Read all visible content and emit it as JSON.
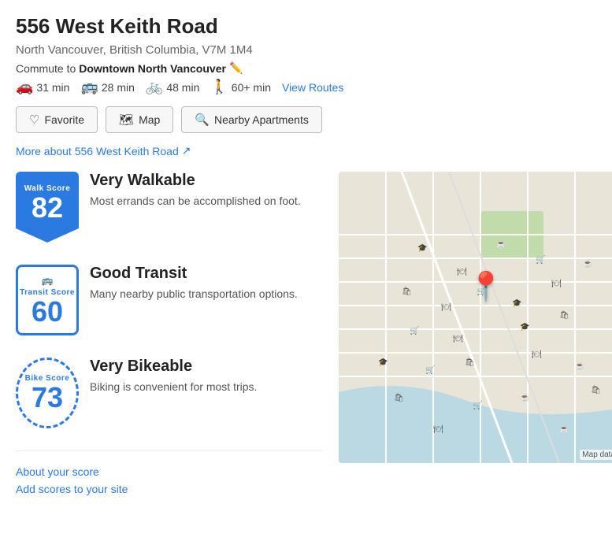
{
  "header": {
    "title": "556 West Keith Road",
    "subtitle": "North Vancouver, British Columbia, V7M 1M4",
    "commute_label": "Commute to",
    "commute_destination": "Downtown North Vancouver",
    "transport": [
      {
        "icon": "🚗",
        "time": "31 min",
        "name": "drive"
      },
      {
        "icon": "🚌",
        "time": "28 min",
        "name": "transit"
      },
      {
        "icon": "🚲",
        "time": "48 min",
        "name": "bike"
      },
      {
        "icon": "🚶",
        "time": "60+ min",
        "name": "walk"
      }
    ],
    "view_routes_label": "View Routes"
  },
  "buttons": [
    {
      "label": "Favorite",
      "icon": "♡",
      "name": "favorite"
    },
    {
      "label": "Map",
      "icon": "🗺",
      "name": "map"
    },
    {
      "label": "Nearby Apartments",
      "icon": "🔍",
      "name": "nearby"
    }
  ],
  "more_link": "More about 556 West Keith Road",
  "scores": [
    {
      "type": "walk",
      "badge_label": "Walk Score",
      "number": "82",
      "title": "Very Walkable",
      "description": "Most errands can be accomplished on foot."
    },
    {
      "type": "transit",
      "badge_label": "Transit Score",
      "number": "60",
      "title": "Good Transit",
      "description": "Many nearby public transportation options."
    },
    {
      "type": "bike",
      "badge_label": "Bike Score",
      "number": "73",
      "title": "Very Bikeable",
      "description": "Biking is convenient for most trips."
    }
  ],
  "score_links": [
    {
      "label": "About your score",
      "name": "about-score"
    },
    {
      "label": "Add scores to your site",
      "name": "add-scores"
    }
  ],
  "map": {
    "label": "Map data"
  }
}
